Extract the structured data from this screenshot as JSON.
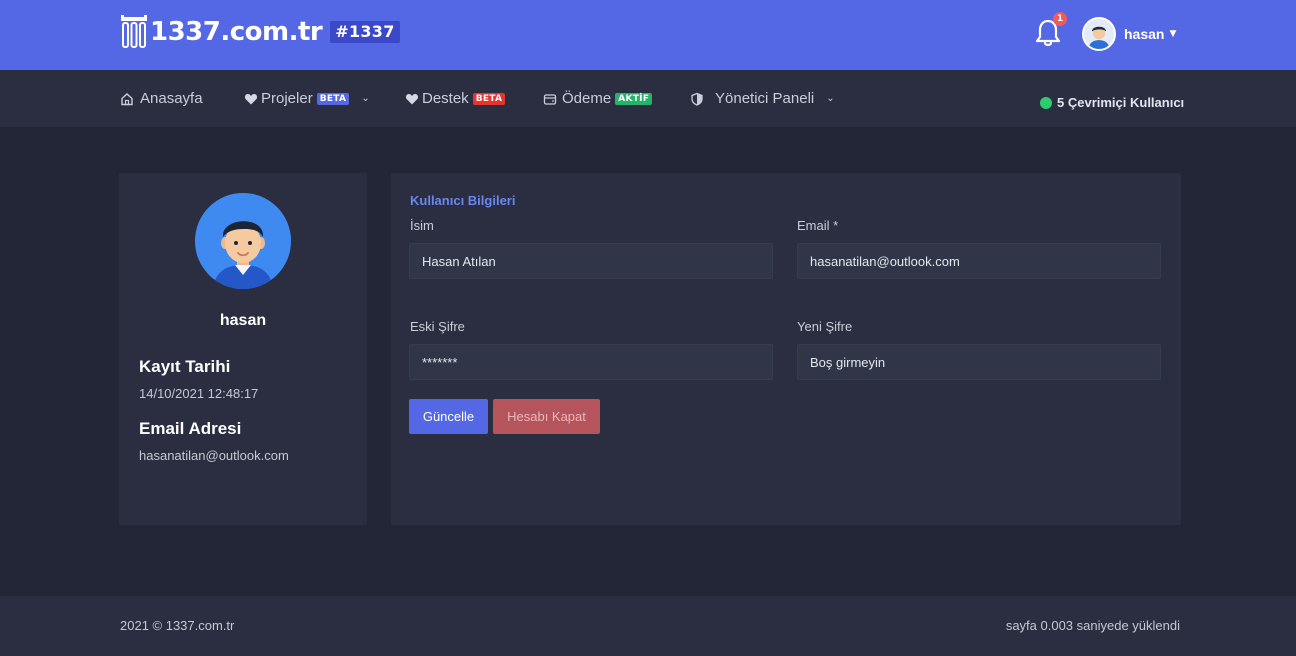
{
  "header": {
    "logo_text": "1337.com.tr",
    "logo_tag": "#1337",
    "notification_count": "1",
    "user_name": "hasan"
  },
  "nav": {
    "items": [
      {
        "label": "Anasayfa",
        "icon": "home-icon"
      },
      {
        "label": "Projeler",
        "icon": "heart-icon",
        "badge": "BETA",
        "badge_color": "#5468e6"
      },
      {
        "label": "Destek",
        "icon": "heart-icon",
        "badge": "BETA",
        "badge_color": "#e8342f"
      },
      {
        "label": "Ödeme",
        "icon": "wallet-icon",
        "badge": "AKTİF",
        "badge_color": "#27b26a"
      },
      {
        "label": "Yönetici Paneli",
        "icon": "shield-icon"
      }
    ],
    "online_text": "5 Çevrimiçi Kullanıcı"
  },
  "profile": {
    "name": "hasan",
    "registered_label": "Kayıt Tarihi",
    "registered_value": "14/10/2021 12:48:17",
    "email_label": "Email Adresi",
    "email_value": "hasanatilan@outlook.com"
  },
  "form": {
    "section_title": "Kullanıcı Bilgileri",
    "name_label": "İsim",
    "name_value": "Hasan Atılan",
    "email_label": "Email *",
    "email_value": "hasanatilan@outlook.com",
    "old_password_label": "Eski Şifre",
    "old_password_value": "*******",
    "new_password_label": "Yeni Şifre",
    "new_password_placeholder": "Boş girmeyin",
    "update_button": "Güncelle",
    "close_account_button": "Hesabı Kapat"
  },
  "footer": {
    "copyright": "2021 © 1337.com.tr",
    "load_time": "sayfa 0.003 saniyede yüklendi"
  },
  "colors": {
    "accent": "#5468e6",
    "background": "#222636",
    "card": "#2a2e40",
    "danger": "#b5545a",
    "online": "#2ecc71"
  }
}
